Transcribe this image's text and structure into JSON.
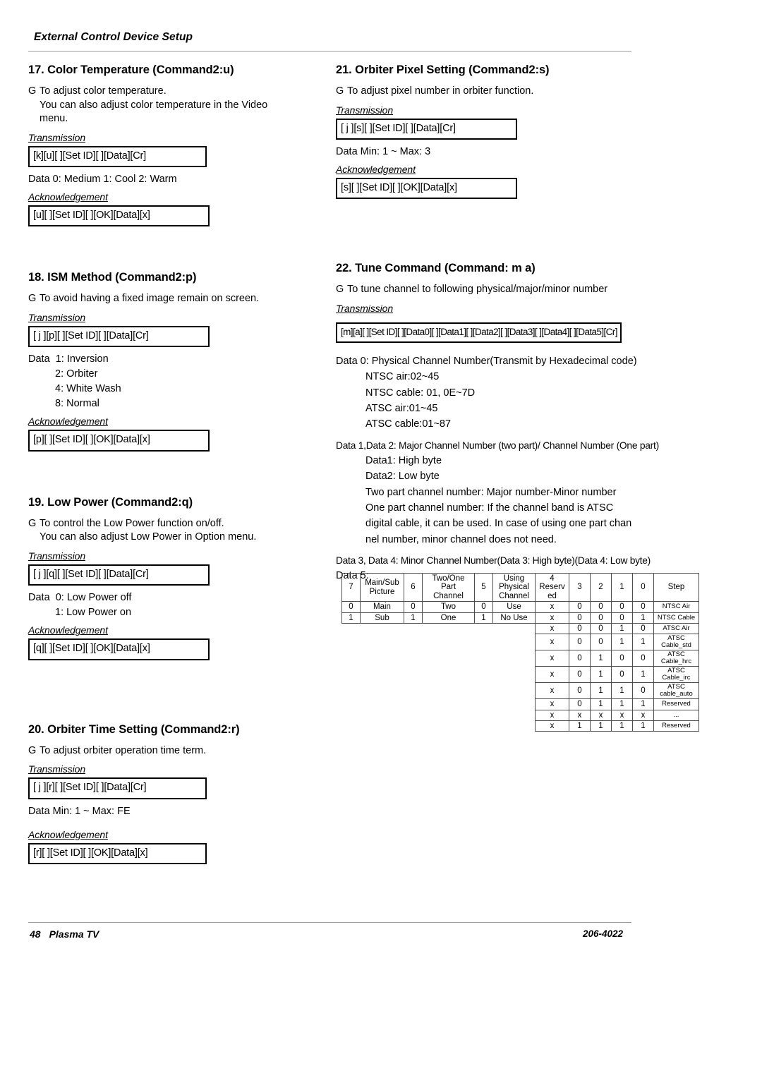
{
  "header": {
    "title": "External Control Device Setup"
  },
  "footer": {
    "page_number": "48",
    "product": "Plasma TV",
    "doc_code": "206-4022"
  },
  "labels": {
    "transmission": "Transmission",
    "acknowledgement": "Acknowledgement",
    "bullet_marker": "G"
  },
  "sections": {
    "s17": {
      "title": "17. Color Temperature (Command2:u)",
      "desc_line1": "To adjust color temperature.",
      "desc_line2": "You can also adjust color temperature in the Video",
      "desc_line3": "menu.",
      "transmission_code": "[k][u][  ][Set ID][  ][Data][Cr]",
      "data_text": "Data   0: Medium     1: Cool   2: Warm",
      "ack_code": "[u][  ][Set ID][  ][OK][Data][x]"
    },
    "s18": {
      "title": "18. ISM Method (Command2:p)",
      "desc_line1": "To avoid having a fixed image remain on screen.",
      "transmission_code": "[ j ][p][  ][Set ID][  ][Data][Cr]",
      "data_label": "Data",
      "data_options": [
        "1: Inversion",
        "2: Orbiter",
        "4: White Wash",
        "8: Normal"
      ],
      "ack_code": "[p][  ][Set ID][  ][OK][Data][x]"
    },
    "s19": {
      "title": "19. Low Power (Command2:q)",
      "desc_line1": "To control the Low Power function on/off.",
      "desc_line2": "You can also adjust Low Power in Option menu.",
      "transmission_code": "[ j ][q][  ][Set ID][  ][Data][Cr]",
      "data_label": "Data",
      "data_options": [
        "0: Low Power off",
        "1: Low Power on"
      ],
      "ack_code": "[q][  ][Set ID][  ][OK][Data][x]"
    },
    "s20": {
      "title": "20. Orbiter Time Setting (Command2:r)",
      "desc_line1": "To adjust orbiter operation time term.",
      "transmission_code": "[ j ][r][  ][Set ID][  ][Data][Cr]",
      "data_text": "Data   Min: 1 ~ Max: FE",
      "ack_code": "[r][  ][Set ID][  ][OK][Data][x]"
    },
    "s21": {
      "title": "21. Orbiter Pixel Setting (Command2:s)",
      "desc_line1": "To adjust pixel number in orbiter function.",
      "transmission_code": "[ j ][s][  ][Set ID][  ][Data][Cr]",
      "data_text": "Data   Min: 1 ~ Max: 3",
      "ack_code": "[s][  ][Set ID][  ][OK][Data][x]"
    },
    "s22": {
      "title": "22. Tune Command (Command: m a)",
      "desc_line1": "To tune channel to following physical/major/minor number",
      "transmission_code": "[m][a][  ][Set ID][  ][Data0][  ][Data1][  ][Data2][  ][Data3][  ][Data4][  ][Data5][Cr]",
      "data0_head": "Data   0: Physical Channel Number(Transmit by Hexadecimal code)",
      "data0_lines": [
        "NTSC air:02~45",
        "NTSC cable: 01, 0E~7D",
        "ATSC air:01~45",
        "ATSC cable:01~87"
      ],
      "data12_head": "Data 1,Data 2: Major Channel Number (two part)/ Channel Number (One part)",
      "data12_lines": [
        "Data1: High byte",
        "Data2: Low byte",
        "Two part channel number: Major number-Minor number",
        "One part channel number: If the channel band is ATSC",
        "digital cable, it can be used. In case of using one part chan",
        "nel number, minor channel does not need."
      ],
      "data34_head": "Data 3, Data 4: Minor Channel Number(Data 3: High byte)(Data 4: Low byte)",
      "data5_head": "Data 5:"
    }
  },
  "step_table": {
    "header": {
      "bit7": "7",
      "bit7_desc_l1": "Main/Sub",
      "bit7_desc_l2": "Picture",
      "bit6": "6",
      "bit6_desc_l1": "Two/One",
      "bit6_desc_l2": "Part",
      "bit6_desc_l3": "Channel",
      "bit5": "5",
      "bit5_desc_l1": "Using",
      "bit5_desc_l2": "Physical",
      "bit5_desc_l3": "Channel",
      "bit4_num": "4",
      "bit4_desc_l1": "Reserv",
      "bit4_desc_l2": "ed",
      "bit3": "3",
      "bit2": "2",
      "bit1": "1",
      "bit0": "0",
      "step": "Step"
    },
    "left_rows": [
      {
        "b7": "0",
        "b7d": "Main",
        "b6": "0",
        "b6d": "Two",
        "b5": "0",
        "b5d": "Use"
      },
      {
        "b7": "1",
        "b7d": "Sub",
        "b6": "1",
        "b6d": "One",
        "b5": "1",
        "b5d": "No Use"
      }
    ],
    "right_rows": [
      {
        "b4": "x",
        "b3": "0",
        "b2": "0",
        "b1": "0",
        "b0": "0",
        "step_l1": "NTSC Air",
        "step_l2": ""
      },
      {
        "b4": "x",
        "b3": "0",
        "b2": "0",
        "b1": "0",
        "b0": "1",
        "step_l1": "NTSC Cable",
        "step_l2": ""
      },
      {
        "b4": "x",
        "b3": "0",
        "b2": "0",
        "b1": "1",
        "b0": "0",
        "step_l1": "ATSC Air",
        "step_l2": ""
      },
      {
        "b4": "x",
        "b3": "0",
        "b2": "0",
        "b1": "1",
        "b0": "1",
        "step_l1": "ATSC",
        "step_l2": "Cable_std"
      },
      {
        "b4": "x",
        "b3": "0",
        "b2": "1",
        "b1": "0",
        "b0": "0",
        "step_l1": "ATSC",
        "step_l2": "Cable_hrc"
      },
      {
        "b4": "x",
        "b3": "0",
        "b2": "1",
        "b1": "0",
        "b0": "1",
        "step_l1": "ATSC",
        "step_l2": "Cable_irc"
      },
      {
        "b4": "x",
        "b3": "0",
        "b2": "1",
        "b1": "1",
        "b0": "0",
        "step_l1": "ATSC",
        "step_l2": "cable_auto"
      },
      {
        "b4": "x",
        "b3": "0",
        "b2": "1",
        "b1": "1",
        "b0": "1",
        "step_l1": "Reserved",
        "step_l2": ""
      },
      {
        "b4": "x",
        "b3": "x",
        "b2": "x",
        "b1": "x",
        "b0": "x",
        "step_l1": "...",
        "step_l2": ""
      },
      {
        "b4": "x",
        "b3": "1",
        "b2": "1",
        "b1": "1",
        "b0": "1",
        "step_l1": "Reserved",
        "step_l2": ""
      }
    ]
  }
}
